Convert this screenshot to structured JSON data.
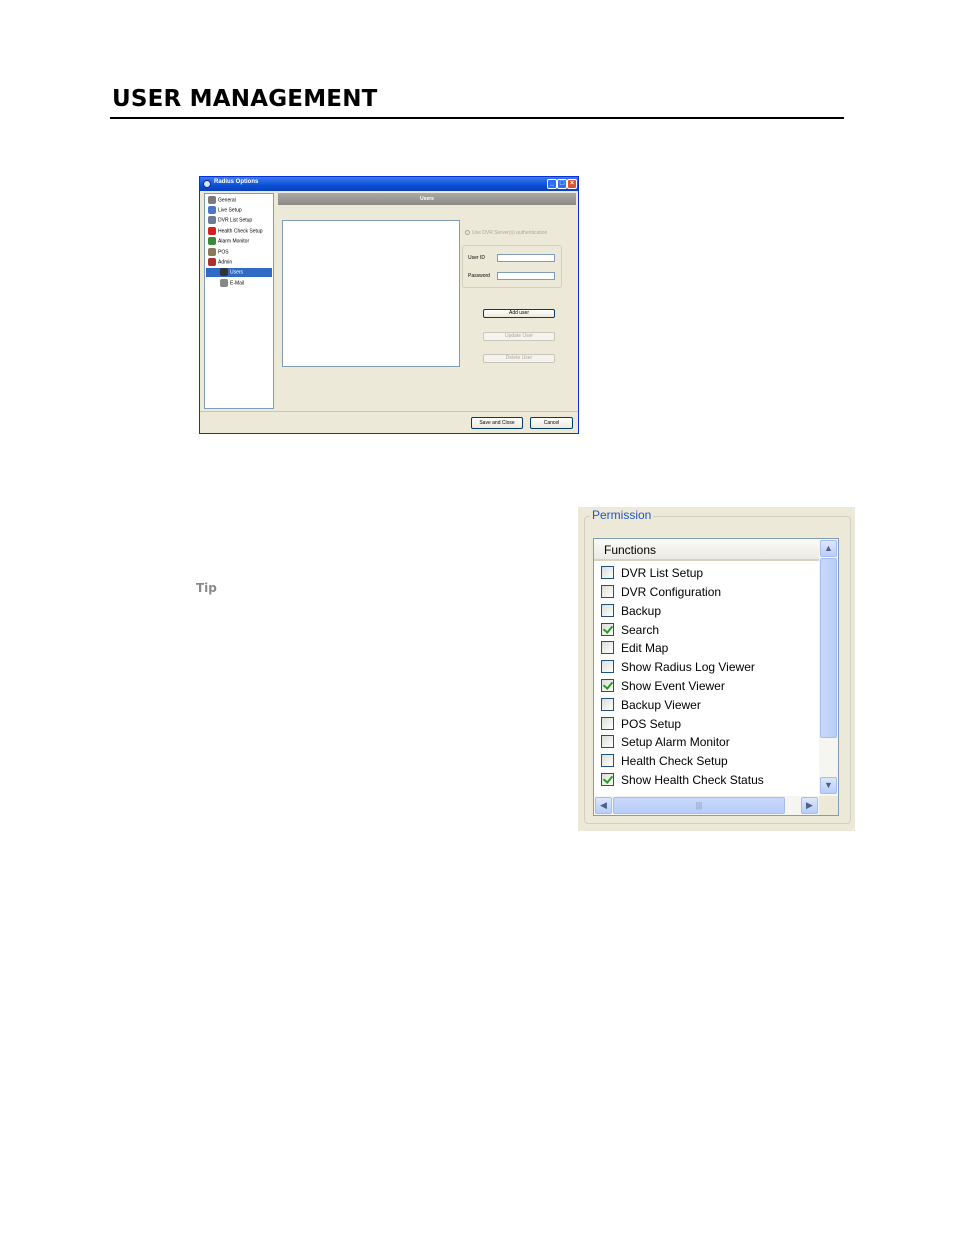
{
  "page": {
    "title": "USER MANAGEMENT",
    "tip_label": "Tip"
  },
  "window": {
    "title": "Radius Options",
    "controls": {
      "minimize": "_",
      "maximize": "□",
      "close": "×"
    },
    "tree": [
      {
        "label": "General",
        "icon": "wrench-icon",
        "color": "#7a7a7a"
      },
      {
        "label": "Live Setup",
        "icon": "camera-icon",
        "color": "#4a78c8"
      },
      {
        "label": "DVR List Setup",
        "icon": "dvr-icon",
        "color": "#6d7d8f"
      },
      {
        "label": "Health Check Setup",
        "icon": "health-cross-icon",
        "color": "#d42020"
      },
      {
        "label": "Alarm Monitor",
        "icon": "alarm-icon",
        "color": "#3a8a3a"
      },
      {
        "label": "POS",
        "icon": "pos-icon",
        "color": "#8a7a5a"
      },
      {
        "label": "Admin",
        "icon": "admin-icon",
        "color": "#b03030"
      },
      {
        "label": "Users",
        "icon": "user-icon",
        "color": "#333333",
        "selected": true
      },
      {
        "label": "E-Mail",
        "icon": "mail-icon",
        "color": "#888888"
      }
    ],
    "users_header": "Users",
    "use_dvr_auth_label": "Use DVR Server(s) authentication",
    "user_id_label": "User ID",
    "password_label": "Password",
    "add_user": "Add user",
    "update_user": "Update User",
    "delete_user": "Delete User",
    "save_close": "Save and Close",
    "cancel": "Cancel"
  },
  "permission": {
    "legend": "Permission",
    "column_header": "Functions",
    "scroll_glyphs": {
      "up": "▲",
      "down": "▼",
      "left": "◀",
      "right": "▶",
      "grip": "|||"
    },
    "items": [
      {
        "label": "DVR List Setup",
        "checked": false
      },
      {
        "label": "DVR Configuration",
        "checked": false
      },
      {
        "label": "Backup",
        "checked": false
      },
      {
        "label": "Search",
        "checked": true
      },
      {
        "label": "Edit Map",
        "checked": false
      },
      {
        "label": "Show Radius Log Viewer",
        "checked": false
      },
      {
        "label": "Show Event Viewer",
        "checked": true
      },
      {
        "label": "Backup Viewer",
        "checked": false
      },
      {
        "label": "POS Setup",
        "checked": false
      },
      {
        "label": "Setup Alarm Monitor",
        "checked": false
      },
      {
        "label": "Health Check Setup",
        "checked": false
      },
      {
        "label": "Show Health Check Status",
        "checked": true
      }
    ]
  }
}
